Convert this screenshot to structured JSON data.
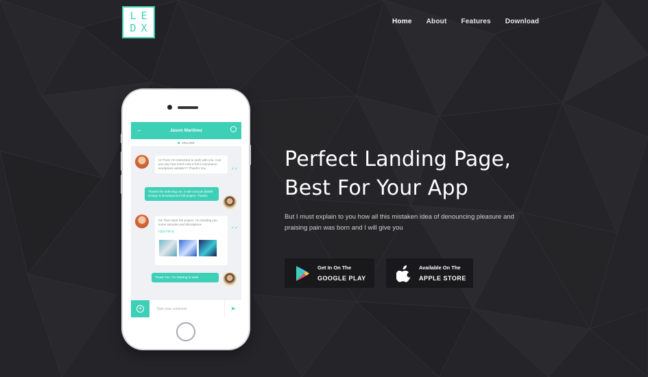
{
  "logo": {
    "letters": [
      "L",
      "E",
      "D",
      "X"
    ]
  },
  "nav": {
    "items": [
      {
        "label": "Home",
        "active": true
      },
      {
        "label": "About",
        "active": false
      },
      {
        "label": "Features",
        "active": false
      },
      {
        "label": "Download",
        "active": false
      }
    ]
  },
  "phone": {
    "chat": {
      "contact_name": "Jason Martinez",
      "status": "ONLINE",
      "messages": [
        {
          "from": "in",
          "text": "Hi There I'm interested to work with you. Can you say how much cost a full e-commerce wordpress website?? Thank's You"
        },
        {
          "from": "out",
          "text": "Thank's for selecting me. It will cost just $2000 Design & Development full project. Thanks"
        },
        {
          "from": "in",
          "text": "Ok Then Start the project. I'm sending you some samples and discriptions",
          "link": "https://bit.ly"
        },
        {
          "from": "out",
          "text": "Thank You. I'm Starting to work"
        }
      ],
      "compose_placeholder": "Type your comment"
    }
  },
  "hero": {
    "headline_line1": "Perfect Landing Page,",
    "headline_line2": "Best For Your App",
    "subtext": "But I must explain to you how all this mistaken idea of denouncing pleasure and praising pain was born and I will give you"
  },
  "store_buttons": {
    "google": {
      "small": "Get In On The",
      "big": "GOOGLE PLAY"
    },
    "apple": {
      "small": "Available On The",
      "big": "APPLE STORE"
    }
  },
  "colors": {
    "accent": "#3ecfb7",
    "background": "#242428",
    "button_bg": "#19191c"
  }
}
